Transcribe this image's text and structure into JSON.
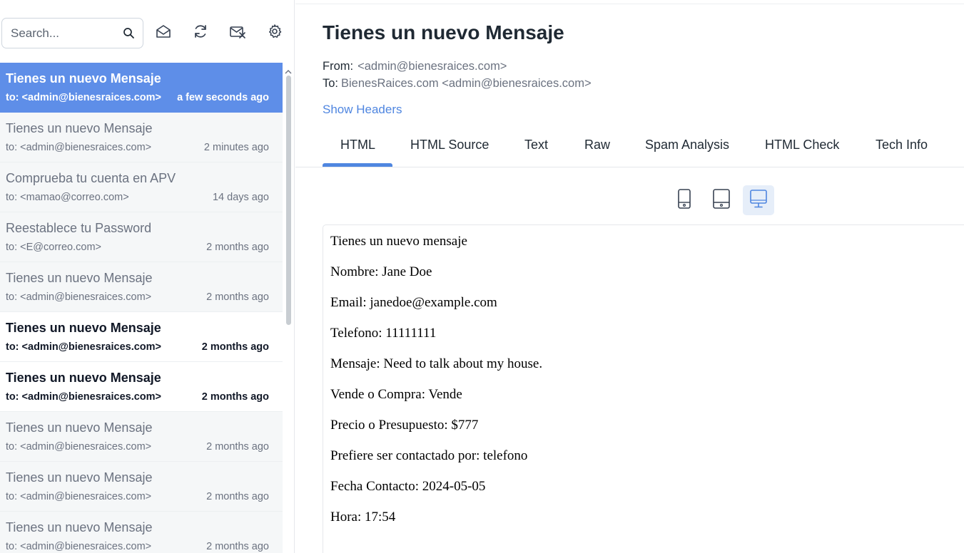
{
  "search": {
    "placeholder": "Search..."
  },
  "toolbar_icons": [
    "search-icon",
    "mark-read-icon",
    "refresh-icon",
    "delete-all-icon",
    "settings-icon"
  ],
  "messages": [
    {
      "subject": "Tienes un nuevo Mensaje",
      "to": "to: <admin@bienesraices.com>",
      "time": "a few seconds ago",
      "state": "selected"
    },
    {
      "subject": "Tienes un nuevo Mensaje",
      "to": "to: <admin@bienesraices.com>",
      "time": "2 minutes ago",
      "state": "read"
    },
    {
      "subject": "Comprueba tu cuenta en APV",
      "to": "to: <mamao@correo.com>",
      "time": "14 days ago",
      "state": "read"
    },
    {
      "subject": "Reestablece tu Password",
      "to": "to: <E@correo.com>",
      "time": "2 months ago",
      "state": "read"
    },
    {
      "subject": "Tienes un nuevo Mensaje",
      "to": "to: <admin@bienesraices.com>",
      "time": "2 months ago",
      "state": "read"
    },
    {
      "subject": "Tienes un nuevo Mensaje",
      "to": "to: <admin@bienesraices.com>",
      "time": "2 months ago",
      "state": "unread"
    },
    {
      "subject": "Tienes un nuevo Mensaje",
      "to": "to: <admin@bienesraices.com>",
      "time": "2 months ago",
      "state": "unread"
    },
    {
      "subject": "Tienes un nuevo Mensaje",
      "to": "to: <admin@bienesraices.com>",
      "time": "2 months ago",
      "state": "read"
    },
    {
      "subject": "Tienes un nuevo Mensaje",
      "to": "to: <admin@bienesraices.com>",
      "time": "2 months ago",
      "state": "read"
    },
    {
      "subject": "Tienes un nuevo Mensaje",
      "to": "to: <admin@bienesraices.com>",
      "time": "2 months ago",
      "state": "read"
    }
  ],
  "message": {
    "title": "Tienes un nuevo Mensaje",
    "from_label": "From:",
    "from_value": "<admin@bienesraices.com>",
    "to_label": "To:",
    "to_value": "BienesRaices.com <admin@bienesraices.com>",
    "show_headers": "Show Headers"
  },
  "tabs": [
    "HTML",
    "HTML Source",
    "Text",
    "Raw",
    "Spam Analysis",
    "HTML Check",
    "Tech Info"
  ],
  "active_tab": "HTML",
  "viewports": [
    "mobile-icon",
    "tablet-icon",
    "desktop-icon"
  ],
  "active_viewport": "desktop-icon",
  "body_lines": [
    "Tienes un nuevo mensaje",
    "Nombre: Jane Doe",
    "Email: janedoe@example.com",
    "Telefono: 11111111",
    "Mensaje: Need to talk about my house.",
    "Vende o Compra: Vende",
    "Precio o Presupuesto: $777",
    "Prefiere ser contactado por: telefono",
    "Fecha Contacto: 2024-05-05",
    "Hora: 17:54"
  ],
  "colors": {
    "accent": "#4f86e0",
    "selected_row": "#5e8ee8"
  }
}
